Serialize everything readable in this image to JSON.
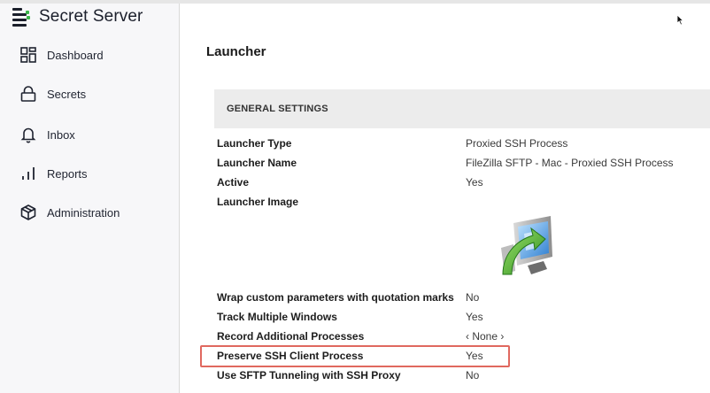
{
  "app": {
    "title": "Secret Server"
  },
  "sidebar": {
    "items": [
      {
        "label": "Dashboard",
        "icon": "dashboard-grid-icon"
      },
      {
        "label": "Secrets",
        "icon": "lock-icon"
      },
      {
        "label": "Inbox",
        "icon": "bell-icon"
      },
      {
        "label": "Reports",
        "icon": "bar-chart-icon"
      },
      {
        "label": "Administration",
        "icon": "cube-icon"
      }
    ]
  },
  "main": {
    "title": "Launcher",
    "section_header": "GENERAL SETTINGS",
    "fields": [
      {
        "label": "Launcher Type",
        "value": "Proxied SSH Process"
      },
      {
        "label": "Launcher Name",
        "value": "FileZilla SFTP - Mac - Proxied SSH Process"
      },
      {
        "label": "Active",
        "value": "Yes"
      },
      {
        "label": "Launcher Image",
        "value": ""
      }
    ],
    "launcher_image_icon": "remote-screen-arrow-icon",
    "fields2": [
      {
        "label": "Wrap custom parameters with quotation marks",
        "value": "No"
      },
      {
        "label": "Track Multiple Windows",
        "value": "Yes"
      },
      {
        "label": "Record Additional Processes",
        "value": "‹ None ›"
      },
      {
        "label": "Preserve SSH Client Process",
        "value": "Yes"
      },
      {
        "label": "Use SFTP Tunneling with SSH Proxy",
        "value": "No"
      }
    ],
    "highlighted_field": "Preserve SSH Client Process",
    "highlight_color": "#e0685f"
  },
  "colors": {
    "sidebar_bg": "#f7f7f9",
    "section_header_bg": "#ececec",
    "logo_green": "#3bb54a"
  }
}
